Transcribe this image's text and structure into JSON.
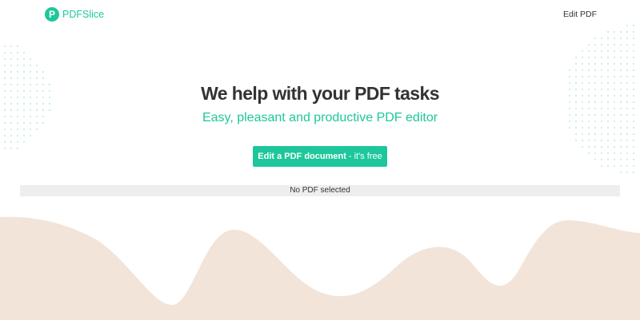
{
  "header": {
    "brand_initial": "P",
    "brand_name": "PDFSlice",
    "nav_edit_pdf": "Edit PDF"
  },
  "hero": {
    "title": "We help with your PDF tasks",
    "subtitle": "Easy, pleasant and productive PDF editor",
    "cta_strong": "Edit a PDF document",
    "cta_suffix": "- it's free"
  },
  "status": {
    "text": "No PDF selected"
  },
  "colors": {
    "accent": "#1ec79b",
    "wave": "#f2e4d8",
    "dots": "#b7ecdc",
    "text": "#333333",
    "status_bg": "#eeeeee"
  },
  "icons": {
    "brand_logo": "p-circle-logo"
  }
}
